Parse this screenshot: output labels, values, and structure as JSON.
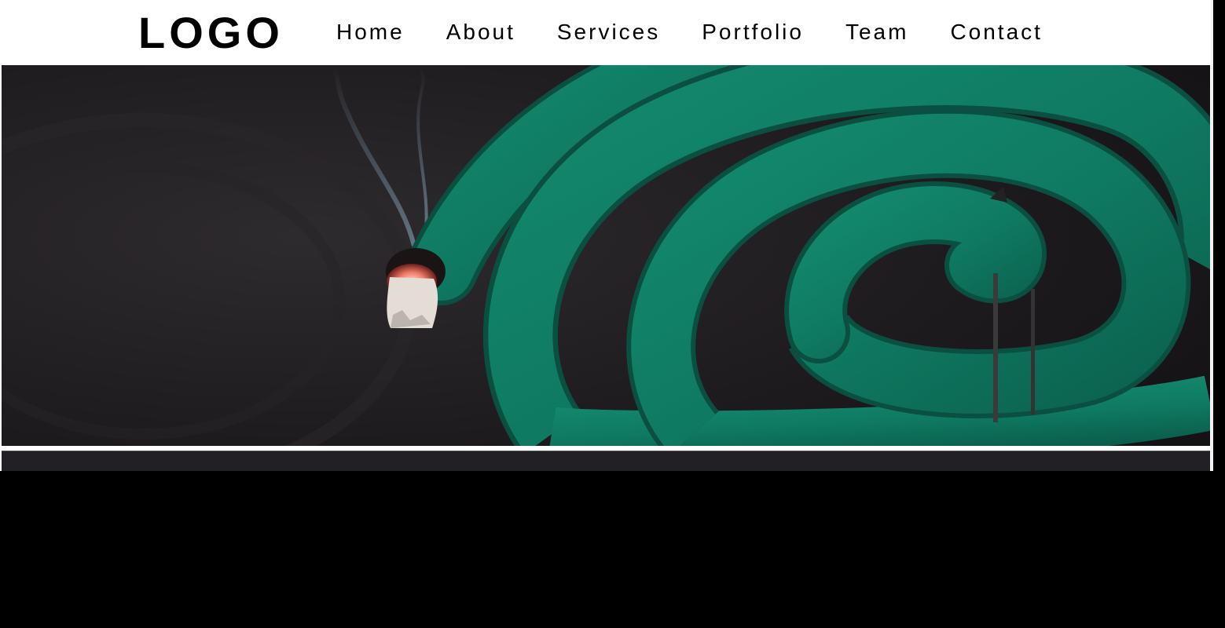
{
  "header": {
    "logo": "LOGO",
    "nav": [
      {
        "label": "Home"
      },
      {
        "label": "About"
      },
      {
        "label": "Services"
      },
      {
        "label": "Portfolio"
      },
      {
        "label": "Team"
      },
      {
        "label": "Contact"
      }
    ]
  },
  "hero": {
    "image": "mosquito-coil-image"
  },
  "colors": {
    "coil_green": "#0f7a62",
    "background_dark": "#1c1a1c",
    "ember": "#e85a4a"
  }
}
